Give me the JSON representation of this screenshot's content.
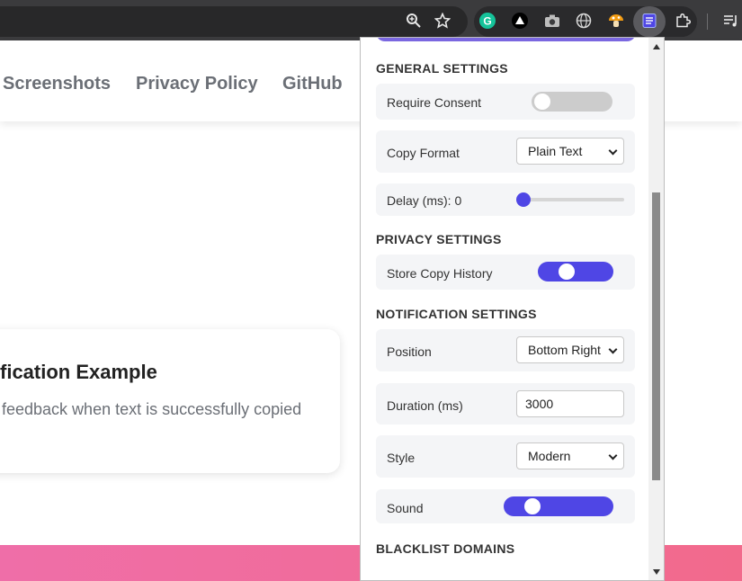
{
  "nav": {
    "links": [
      "Screenshots",
      "Privacy Policy",
      "GitHub"
    ]
  },
  "card": {
    "title": "fication Example",
    "description": "feedback when text is successfully copied"
  },
  "popup": {
    "general": {
      "heading": "GENERAL SETTINGS",
      "require_consent": {
        "label": "Require Consent",
        "enabled": false
      },
      "copy_format": {
        "label": "Copy Format",
        "value": "Plain Text"
      },
      "delay": {
        "label": "Delay (ms): 0",
        "value": 0
      }
    },
    "privacy": {
      "heading": "PRIVACY SETTINGS",
      "store_history": {
        "label": "Store Copy History",
        "enabled": true
      }
    },
    "notification": {
      "heading": "NOTIFICATION SETTINGS",
      "position": {
        "label": "Position",
        "value": "Bottom Right"
      },
      "duration": {
        "label": "Duration (ms)",
        "value": "3000"
      },
      "style": {
        "label": "Style",
        "value": "Modern"
      },
      "sound": {
        "label": "Sound",
        "enabled": true
      }
    },
    "blacklist": {
      "heading": "BLACKLIST DOMAINS"
    }
  },
  "icons": [
    "zoom-icon",
    "star-icon",
    "grammarly-icon",
    "triangle-icon",
    "camera-icon",
    "globe-icon",
    "mushroom-icon",
    "copy-extension-icon",
    "puzzle-icon",
    "media-icon"
  ],
  "colors": {
    "accent": "#4f46e5",
    "toggle_off": "#cccccc",
    "footer": "#ef6ea8"
  }
}
